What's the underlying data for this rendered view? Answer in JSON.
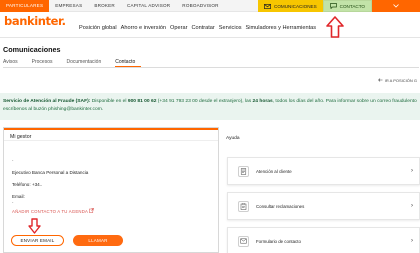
{
  "top_nav": {
    "items": [
      "PARTICULARES",
      "EMPRESAS",
      "BROKER",
      "CAPITAL ADVISOR",
      "ROBOADVISOR"
    ],
    "comunicaciones_label": "COMUNICACIONES",
    "contacto_label": "CONTACTO"
  },
  "brand": {
    "logo_text": "bankinter."
  },
  "main_nav": {
    "items": [
      "Posición global",
      "Ahorro e inversión",
      "Operar",
      "Contratar",
      "Servicios",
      "Simuladores y Herramientas"
    ]
  },
  "page": {
    "title": "Comunicaciones",
    "tabs": [
      "Avisos",
      "Procesos",
      "Documentación",
      "Contacto"
    ],
    "active_tab": "Contacto",
    "back_link": "IR A POSICIÓN G"
  },
  "notice": {
    "title": "Servicio de Atención al Fraude (SAF):",
    "text_1": "Disponible en el",
    "phone_1": "900 81 00 62",
    "text_2": "(+34 91 793 23 00 desde el extranjero), las",
    "hours": "24 horas",
    "text_3": ", todos los días del año. Para informar sobre un correo fraudulento escríbenos al buzón",
    "email": "phishing@bankinter.com",
    "text_4": "."
  },
  "gestor": {
    "header": "Mi gestor",
    "role": "Ejecutivo Banca Personal a Distancia",
    "phone_label": "Teléfono:",
    "phone_value": "+34..",
    "email_label": "Email:",
    "add_contact_label": "AÑADIR CONTACTO A TU AGENDA",
    "send_email_label": "ENVIAR EMAIL",
    "call_label": "LLAMAR"
  },
  "ayuda": {
    "title": "Ayuda",
    "items": [
      "Atención al cliente",
      "Consultar reclamaciones",
      "Formulario de contacto"
    ]
  },
  "colors": {
    "accent": "#ff6600",
    "notice_bg": "#eaf4ef",
    "notice_text": "#1e6b3d",
    "annotation_red": "#e0262a"
  }
}
